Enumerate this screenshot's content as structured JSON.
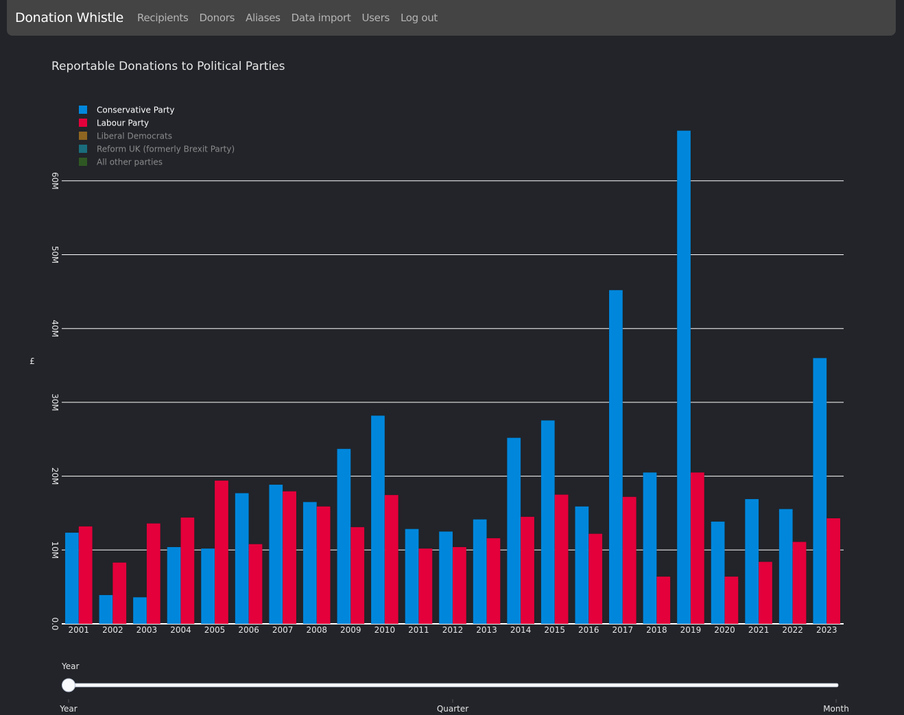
{
  "navbar": {
    "brand": "Donation Whistle",
    "links": [
      "Recipients",
      "Donors",
      "Aliases",
      "Data import",
      "Users",
      "Log out"
    ]
  },
  "slider": {
    "current_label": "Year",
    "options": [
      "Year",
      "Quarter",
      "Month"
    ],
    "selected": "Year"
  },
  "chart_data": {
    "type": "bar",
    "title": "Reportable Donations to Political Parties",
    "xlabel": "",
    "ylabel": "£",
    "ylim": [
      0,
      70000000
    ],
    "yticks": [
      0,
      10000000,
      20000000,
      30000000,
      40000000,
      50000000,
      60000000
    ],
    "ytick_labels": [
      "0.0",
      "10M",
      "20M",
      "30M",
      "40M",
      "50M",
      "60M"
    ],
    "grid": true,
    "legend_position": "top-left",
    "categories": [
      "2001",
      "2002",
      "2003",
      "2004",
      "2005",
      "2006",
      "2007",
      "2008",
      "2009",
      "2010",
      "2011",
      "2012",
      "2013",
      "2014",
      "2015",
      "2016",
      "2017",
      "2018",
      "2019",
      "2020",
      "2021",
      "2022",
      "2023"
    ],
    "series": [
      {
        "name": "Conservative Party",
        "color": "#0087DC",
        "visible": true,
        "values": [
          12.35,
          3.9,
          3.6,
          10.4,
          10.2,
          17.7,
          18.85,
          16.5,
          23.7,
          28.2,
          12.85,
          12.5,
          14.15,
          25.2,
          27.55,
          15.9,
          45.2,
          20.5,
          66.8,
          13.85,
          16.9,
          15.55,
          36.0
        ]
      },
      {
        "name": "Labour Party",
        "color": "#E4003B",
        "visible": true,
        "values": [
          13.2,
          8.3,
          13.6,
          14.4,
          19.4,
          10.8,
          17.95,
          15.9,
          13.1,
          17.45,
          10.2,
          10.4,
          11.6,
          14.5,
          17.5,
          12.2,
          17.2,
          6.4,
          20.5,
          6.4,
          8.4,
          11.1,
          14.3
        ]
      },
      {
        "name": "Liberal Democrats",
        "color": "#FAA61A",
        "visible": false,
        "values": []
      },
      {
        "name": "Reform UK (formerly Brexit Party)",
        "color": "#12B6CF",
        "visible": false,
        "values": []
      },
      {
        "name": "All other parties",
        "color": "#3B8A1E",
        "visible": false,
        "values": []
      }
    ],
    "value_unit": "millions GBP"
  }
}
